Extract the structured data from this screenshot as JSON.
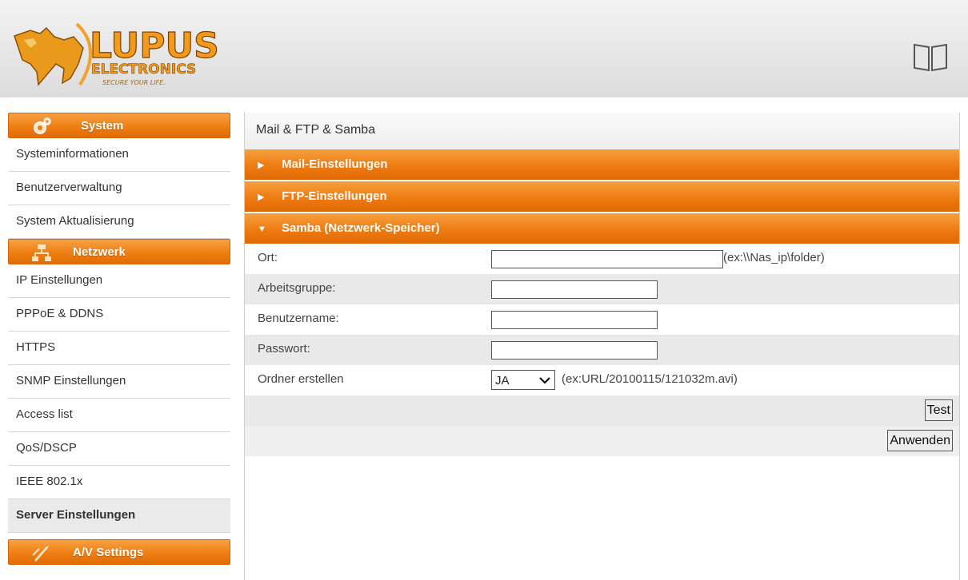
{
  "header": {
    "logo_text": "LUPUS",
    "logo_subtext": "ELECTRONICS",
    "logo_tagline": "SECURE YOUR LIFE."
  },
  "sidebar": {
    "system_label": "System",
    "system_items": [
      "Systeminformationen",
      "Benutzerverwaltung",
      "System Aktualisierung"
    ],
    "network_label": "Netzwerk",
    "network_items": [
      "IP Einstellungen",
      "PPPoE & DDNS",
      "HTTPS",
      "SNMP Einstellungen",
      "Access list",
      "QoS/DSCP",
      "IEEE 802.1x",
      "Server Einstellungen"
    ],
    "active_item": "Server Einstellungen",
    "av_label": "A/V Settings"
  },
  "main": {
    "title": "Mail & FTP & Samba",
    "sections": [
      "Mail-Einstellungen",
      "FTP-Einstellungen",
      "Samba (Netzwerk-Speicher)"
    ],
    "fields": {
      "ort_label": "Ort:",
      "ort_value": "",
      "ort_hint": "(ex:\\\\Nas_ip\\folder)",
      "arbeitsgruppe_label": "Arbeitsgruppe:",
      "arbeitsgruppe_value": "",
      "benutzername_label": "Benutzername:",
      "benutzername_value": "",
      "passwort_label": "Passwort:",
      "passwort_value": "",
      "ordner_label": "Ordner erstellen",
      "ordner_value": "JA",
      "ordner_hint": "(ex:URL/20100115/121032m.avi)"
    },
    "test_button": "Test",
    "apply_button": "Anwenden"
  },
  "colors": {
    "accent": "#ee7b10",
    "row_alt": "#e9e9e9"
  }
}
